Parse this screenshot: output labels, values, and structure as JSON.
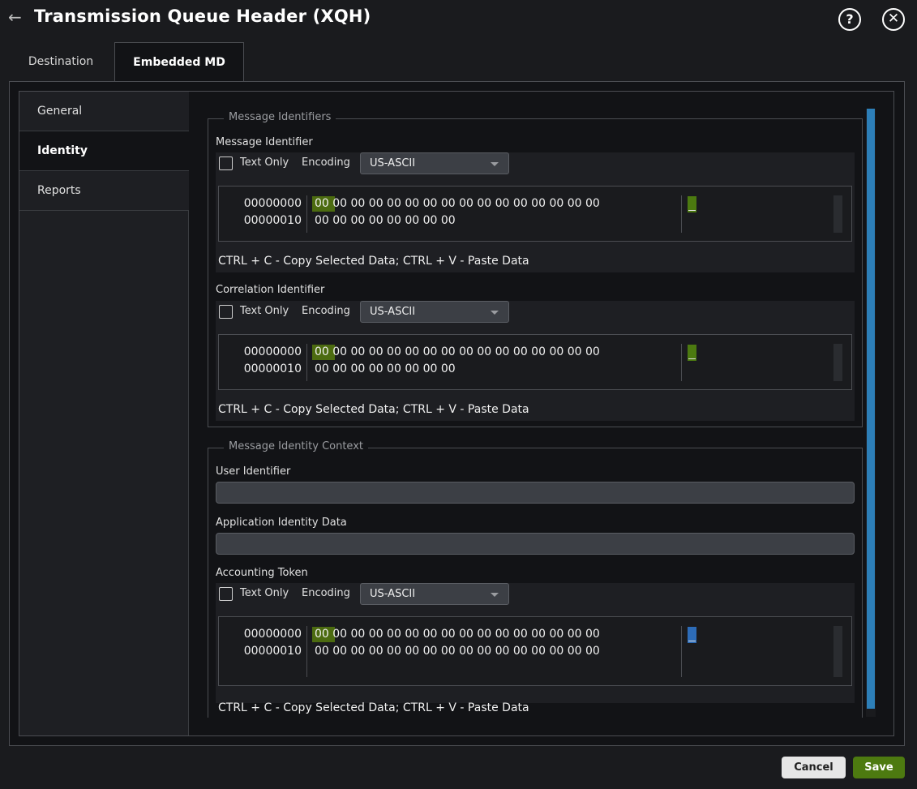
{
  "header": {
    "back_icon": "arrow-left-icon",
    "title": "Transmission Queue Header (XQH)",
    "help_icon": "question-circle-icon",
    "close_icon": "close-circle-icon"
  },
  "tabs": [
    {
      "label": "Destination",
      "active": false
    },
    {
      "label": "Embedded MD",
      "active": true
    }
  ],
  "sidenav": [
    {
      "label": "General",
      "active": false
    },
    {
      "label": "Identity",
      "active": true
    },
    {
      "label": "Reports",
      "active": false
    }
  ],
  "groups": {
    "message_identifiers": {
      "legend": "Message Identifiers",
      "message_identifier": {
        "label": "Message Identifier",
        "text_only": "Text Only",
        "encoding_label": "Encoding",
        "encoding_value": "US-ASCII",
        "offsets": "00000000\n00000010",
        "bytes": "00 00 00 00 00 00 00 00 00 00 00 00 00 00 00 00\n00 00 00 00 00 00 00 00",
        "hint": "CTRL + C - Copy Selected Data; CTRL + V - Paste Data"
      },
      "correlation_identifier": {
        "label": "Correlation Identifier",
        "text_only": "Text Only",
        "encoding_label": "Encoding",
        "encoding_value": "US-ASCII",
        "offsets": "00000000\n00000010",
        "bytes": "00 00 00 00 00 00 00 00 00 00 00 00 00 00 00 00\n00 00 00 00 00 00 00 00",
        "hint": "CTRL + C - Copy Selected Data; CTRL + V - Paste Data"
      }
    },
    "message_identity_context": {
      "legend": "Message Identity Context",
      "user_identifier": {
        "label": "User Identifier",
        "value": ""
      },
      "application_identity_data": {
        "label": "Application Identity Data",
        "value": ""
      },
      "accounting_token": {
        "label": "Accounting Token",
        "text_only": "Text Only",
        "encoding_label": "Encoding",
        "encoding_value": "US-ASCII",
        "offsets": "00000000\n00000010",
        "bytes": "00 00 00 00 00 00 00 00 00 00 00 00 00 00 00 00\n00 00 00 00 00 00 00 00 00 00 00 00 00 00 00 00",
        "hint": "CTRL + C - Copy Selected Data; CTRL + V - Paste Data"
      }
    }
  },
  "footer": {
    "cancel_label": "Cancel",
    "save_label": "Save"
  },
  "colors": {
    "accent_green": "#4d7a10",
    "scrollbar_blue": "#2d7fb8",
    "background": "#121316"
  }
}
